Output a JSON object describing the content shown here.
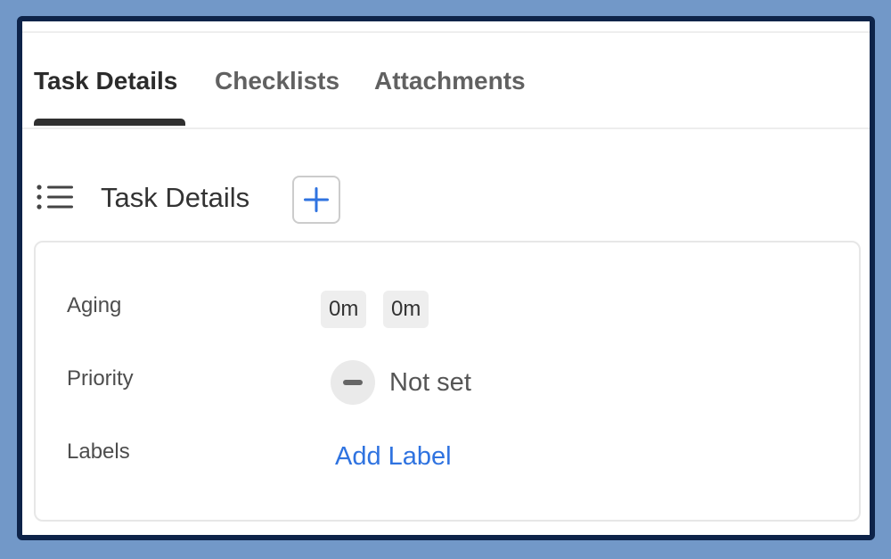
{
  "tabs": [
    {
      "label": "Task Details",
      "active": true
    },
    {
      "label": "Checklists",
      "active": false
    },
    {
      "label": "Attachments",
      "active": false
    }
  ],
  "section": {
    "title": "Task Details",
    "list_icon": "list-icon",
    "add_icon": "plus-icon"
  },
  "details": {
    "aging": {
      "label": "Aging",
      "values": [
        "0m",
        "0m"
      ]
    },
    "priority": {
      "label": "Priority",
      "value": "Not set",
      "icon": "minus-circle-icon"
    },
    "labels": {
      "label": "Labels",
      "action": "Add Label"
    }
  },
  "colors": {
    "accent": "#2f73e0",
    "frame_border": "#0d2349",
    "outer_background": "#7298c8"
  }
}
